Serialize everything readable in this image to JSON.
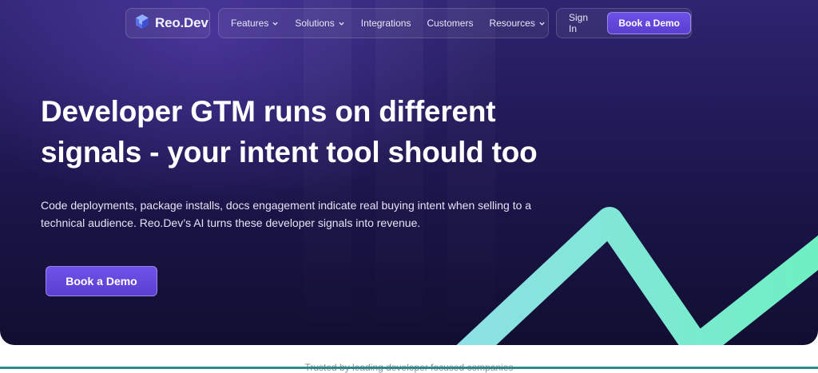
{
  "header": {
    "logo": {
      "text": "Reo.Dev",
      "icon": "reo-cube-logo-icon"
    },
    "nav": [
      {
        "label": "Features",
        "has_dropdown": true
      },
      {
        "label": "Solutions",
        "has_dropdown": true
      },
      {
        "label": "Integrations",
        "has_dropdown": false
      },
      {
        "label": "Customers",
        "has_dropdown": false
      },
      {
        "label": "Resources",
        "has_dropdown": true
      }
    ],
    "sign_in": "Sign In",
    "cta": "Book a Demo"
  },
  "hero": {
    "headline_line1": "Developer GTM runs on different",
    "headline_line2": "signals - your intent tool should too",
    "subcopy_line1": "Code deployments, package installs, docs engagement indicate real buying intent when selling to a",
    "subcopy_line2": "technical audience. Reo.Dev’s AI turns these developer signals into revenue.",
    "cta": "Book a Demo"
  },
  "trusted_text": "Trusted by leading developer focused companies",
  "colors": {
    "hero_bg_top": "#2e2470",
    "hero_bg_bottom": "#120e31",
    "accent_purple": "#6d50e6",
    "signal_line_start": "#8fe0e6",
    "signal_line_end": "#6ef0c2"
  }
}
